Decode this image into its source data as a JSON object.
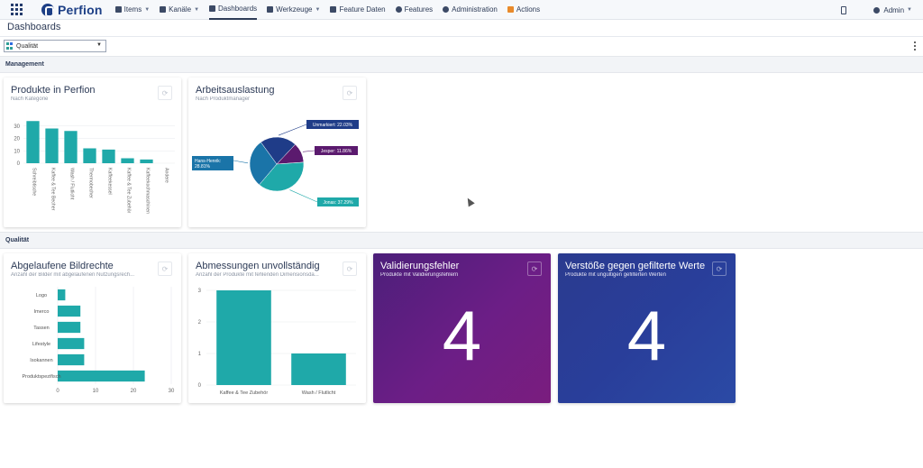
{
  "app": {
    "brand": "Perfion"
  },
  "nav": [
    {
      "label": "Items",
      "icon": "items-icon",
      "has_dropdown": true
    },
    {
      "label": "Kanäle",
      "icon": "channels-icon",
      "has_dropdown": true
    },
    {
      "label": "Dashboards",
      "icon": "dashboards-icon",
      "has_dropdown": false,
      "active": true
    },
    {
      "label": "Werkzeuge",
      "icon": "tools-icon",
      "has_dropdown": true
    },
    {
      "label": "Feature Daten",
      "icon": "feature-data-icon",
      "has_dropdown": false
    },
    {
      "label": "Features",
      "icon": "features-icon",
      "has_dropdown": false
    },
    {
      "label": "Administration",
      "icon": "administration-icon",
      "has_dropdown": false
    },
    {
      "label": "Actions",
      "icon": "actions-icon",
      "has_dropdown": false
    }
  ],
  "user": {
    "name": "Admin"
  },
  "page": {
    "title": "Dashboards"
  },
  "selector": {
    "value": "Qualität"
  },
  "sections": {
    "management": "Management",
    "quality": "Qualität"
  },
  "cards": {
    "products": {
      "title": "Produkte in Perfion",
      "subtitle": "Nach Kategorie"
    },
    "workload": {
      "title": "Arbeitsauslastung",
      "subtitle": "Nach Produktmanager"
    },
    "expired_rights": {
      "title": "Abgelaufene Bildrechte",
      "subtitle": "Anzahl der Bilder mit abgelaufenen Nutzungsrech..."
    },
    "dimensions": {
      "title": "Abmessungen unvollständig",
      "subtitle": "Anzahl der Produkte mit fehlenden Dimensionsda..."
    },
    "validation": {
      "title": "Validierungsfehler",
      "subtitle": "Produkte mit Validierungsfehlern",
      "value": "4"
    },
    "violations": {
      "title": "Verstöße gegen gefilterte Werte",
      "subtitle": "Produkte mit ungültigen gefilterten Werten",
      "value": "4"
    }
  },
  "colors": {
    "teal": "#1fa9a9",
    "navy": "#1f3c88",
    "purple": "#5b1a6e",
    "kpi_purple": "#6c1e86",
    "kpi_blue": "#293e9a"
  },
  "chart_data": [
    {
      "type": "bar",
      "categories": [
        "Schreibtische",
        "Kaffee & Tee Becher",
        "Wash / Flutlicht",
        "Thermobecher",
        "Kaffeekessel",
        "Kaffee & Tee Zubehör",
        "Kaffeekochmaschinen",
        "Andere"
      ],
      "values": [
        34,
        28,
        26,
        12,
        11,
        4,
        3,
        0
      ],
      "yticks": [
        0,
        10,
        20,
        30
      ],
      "ylim": [
        0,
        40
      ]
    },
    {
      "type": "pie",
      "slices": [
        {
          "label": "Unmarkiert: 22.03%",
          "value": 22.03,
          "color": "#1f3c88"
        },
        {
          "label": "Jesper: 11.86%",
          "value": 11.86,
          "color": "#5b1a6e"
        },
        {
          "label": "Jonas: 37.29%",
          "value": 37.29,
          "color": "#1fa9a9"
        },
        {
          "label": "Hans-Henrik: 28.81%",
          "value": 28.81,
          "color": "#1a74a8"
        }
      ]
    },
    {
      "type": "bar",
      "orientation": "horizontal",
      "categories": [
        "Logo",
        "Imerco",
        "Tassen",
        "Lifestyle",
        "Isokannen",
        "Produktspezifisch"
      ],
      "values": [
        2,
        6,
        6,
        7,
        7,
        23
      ],
      "xticks": [
        0,
        10,
        20,
        30
      ],
      "xlim": [
        0,
        30
      ]
    },
    {
      "type": "bar",
      "categories": [
        "Kaffee & Tee Zubehör",
        "Wash / Flutlicht"
      ],
      "values": [
        3,
        1
      ],
      "yticks": [
        0,
        1,
        2,
        3
      ],
      "ylim": [
        0,
        3
      ]
    }
  ]
}
